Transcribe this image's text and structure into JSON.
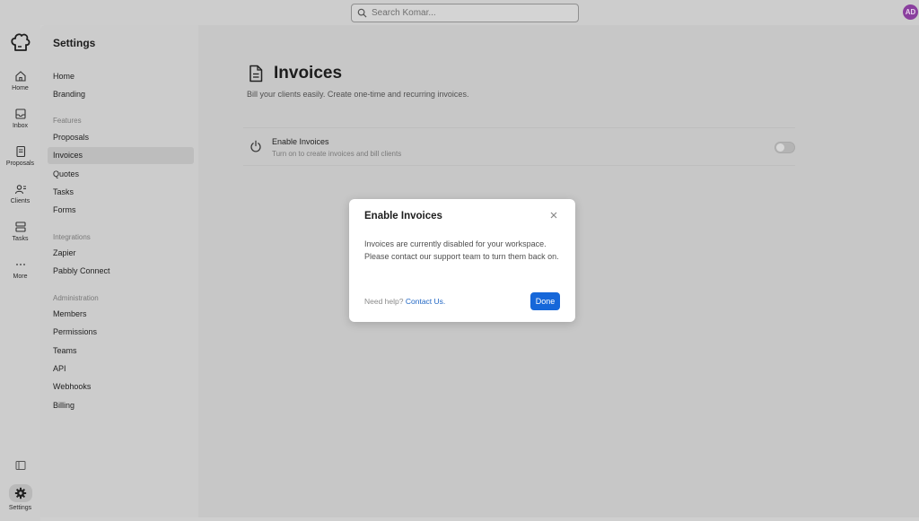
{
  "topbar": {
    "search_placeholder": "Search Komar...",
    "avatar_initials": "AD"
  },
  "rail": {
    "items": [
      {
        "label": "Home",
        "icon": "home-icon"
      },
      {
        "label": "Inbox",
        "icon": "inbox-icon"
      },
      {
        "label": "Proposals",
        "icon": "proposals-icon"
      },
      {
        "label": "Clients",
        "icon": "clients-icon"
      },
      {
        "label": "Tasks",
        "icon": "tasks-icon"
      },
      {
        "label": "More",
        "icon": "more-icon"
      }
    ],
    "settings_label": "Settings"
  },
  "sidebar": {
    "title": "Settings",
    "items": {
      "home": "Home",
      "branding": "Branding"
    },
    "features": {
      "heading": "Features",
      "proposals": "Proposals",
      "invoices": "Invoices",
      "quotes": "Quotes",
      "tasks": "Tasks",
      "forms": "Forms"
    },
    "integrations": {
      "heading": "Integrations",
      "zapier": "Zapier",
      "pabbly": "Pabbly Connect"
    },
    "administration": {
      "heading": "Administration",
      "members": "Members",
      "permissions": "Permissions",
      "teams": "Teams",
      "api": "API",
      "webhooks": "Webhooks",
      "billing": "Billing"
    }
  },
  "main": {
    "title": "Invoices",
    "subtitle": "Bill your clients easily. Create one-time and recurring invoices.",
    "option": {
      "title": "Enable Invoices",
      "description": "Turn on to create invoices and bill clients",
      "enabled": false
    }
  },
  "modal": {
    "title": "Enable Invoices",
    "body": "Invoices are currently disabled for your workspace. Please contact our support team to turn them back on.",
    "help_prefix": "Need help?",
    "help_link": "Contact Us.",
    "done_label": "Done"
  },
  "colors": {
    "accent": "#1667d9",
    "link": "#2167c4",
    "avatar": "#8a3f9e"
  }
}
